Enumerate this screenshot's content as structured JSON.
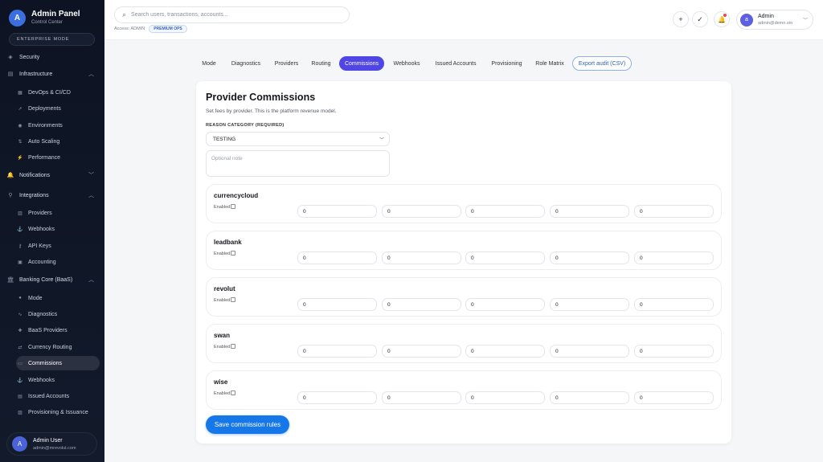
{
  "brand": {
    "logo_letter": "A",
    "title": "Admin Panel",
    "subtitle": "Control Center",
    "mode": "ENTERPRISE MODE"
  },
  "sidebar": {
    "items": [
      {
        "label": "Security",
        "icon": "shield-icon"
      },
      {
        "label": "Infrastructure",
        "icon": "server-icon"
      },
      {
        "label": "DevOps & CI/CD",
        "icon": "pipeline-icon"
      },
      {
        "label": "Deployments",
        "icon": "rocket-icon"
      },
      {
        "label": "Environments",
        "icon": "globe-icon"
      },
      {
        "label": "Auto Scaling",
        "icon": "scale-icon"
      },
      {
        "label": "Performance",
        "icon": "bolt-icon"
      },
      {
        "label": "Notifications",
        "icon": "bell-icon"
      },
      {
        "label": "Integrations",
        "icon": "plug-icon"
      },
      {
        "label": "Providers",
        "icon": "grid-icon"
      },
      {
        "label": "Webhooks",
        "icon": "hook-icon"
      },
      {
        "label": "API Keys",
        "icon": "key-icon"
      },
      {
        "label": "Accounting",
        "icon": "ledger-icon"
      },
      {
        "label": "Banking Core (BaaS)",
        "icon": "bank-icon"
      },
      {
        "label": "Mode",
        "icon": "dot-icon"
      },
      {
        "label": "Diagnostics",
        "icon": "pulse-icon"
      },
      {
        "label": "BaaS Providers",
        "icon": "puzzle-icon"
      },
      {
        "label": "Currency Routing",
        "icon": "route-icon"
      },
      {
        "label": "Commissions",
        "icon": "card-icon"
      },
      {
        "label": "Webhooks",
        "icon": "hook-icon"
      },
      {
        "label": "Issued Accounts",
        "icon": "folder-icon"
      },
      {
        "label": "Provisioning & Issuance",
        "icon": "box-icon"
      }
    ],
    "user": {
      "avatar_letter": "A",
      "name": "Admin User",
      "email": "admin@mrevolut.com"
    }
  },
  "topbar": {
    "search_placeholder": "Search users, transactions, accounts...",
    "access_label": "Access: ADMIN",
    "access_badge": "PREMIUM OPS",
    "account": {
      "avatar_letter": "a",
      "name": "Admin",
      "email": "admin@demo.sm"
    }
  },
  "tabs": [
    {
      "label": "Mode"
    },
    {
      "label": "Diagnostics"
    },
    {
      "label": "Providers"
    },
    {
      "label": "Routing"
    },
    {
      "label": "Commissions"
    },
    {
      "label": "Webhooks"
    },
    {
      "label": "Issued Accounts"
    },
    {
      "label": "Provisioning"
    },
    {
      "label": "Role Matrix"
    },
    {
      "label": "Export audit (CSV)"
    }
  ],
  "main": {
    "title": "Provider Commissions",
    "description": "Set fees by provider. This is the platform revenue model.",
    "reason_label": "REASON CATEGORY (REQUIRED)",
    "reason_value": "TESTING",
    "note_placeholder": "Optional note",
    "enabled_label": "Enabled",
    "providers": [
      {
        "name": "currencycloud",
        "values": [
          "0",
          "0",
          "0",
          "0",
          "0"
        ]
      },
      {
        "name": "leadbank",
        "values": [
          "0",
          "0",
          "0",
          "0",
          "0"
        ]
      },
      {
        "name": "revolut",
        "values": [
          "0",
          "0",
          "0",
          "0",
          "0"
        ]
      },
      {
        "name": "swan",
        "values": [
          "0",
          "0",
          "0",
          "0",
          "0"
        ]
      },
      {
        "name": "wise",
        "values": [
          "0",
          "0",
          "0",
          "0",
          "0"
        ]
      }
    ],
    "save_label": "Save commission rules"
  },
  "colors": {
    "accent": "#4f46e5",
    "primary_button": "#1677e8",
    "sidebar_bg": "#0d1322"
  }
}
